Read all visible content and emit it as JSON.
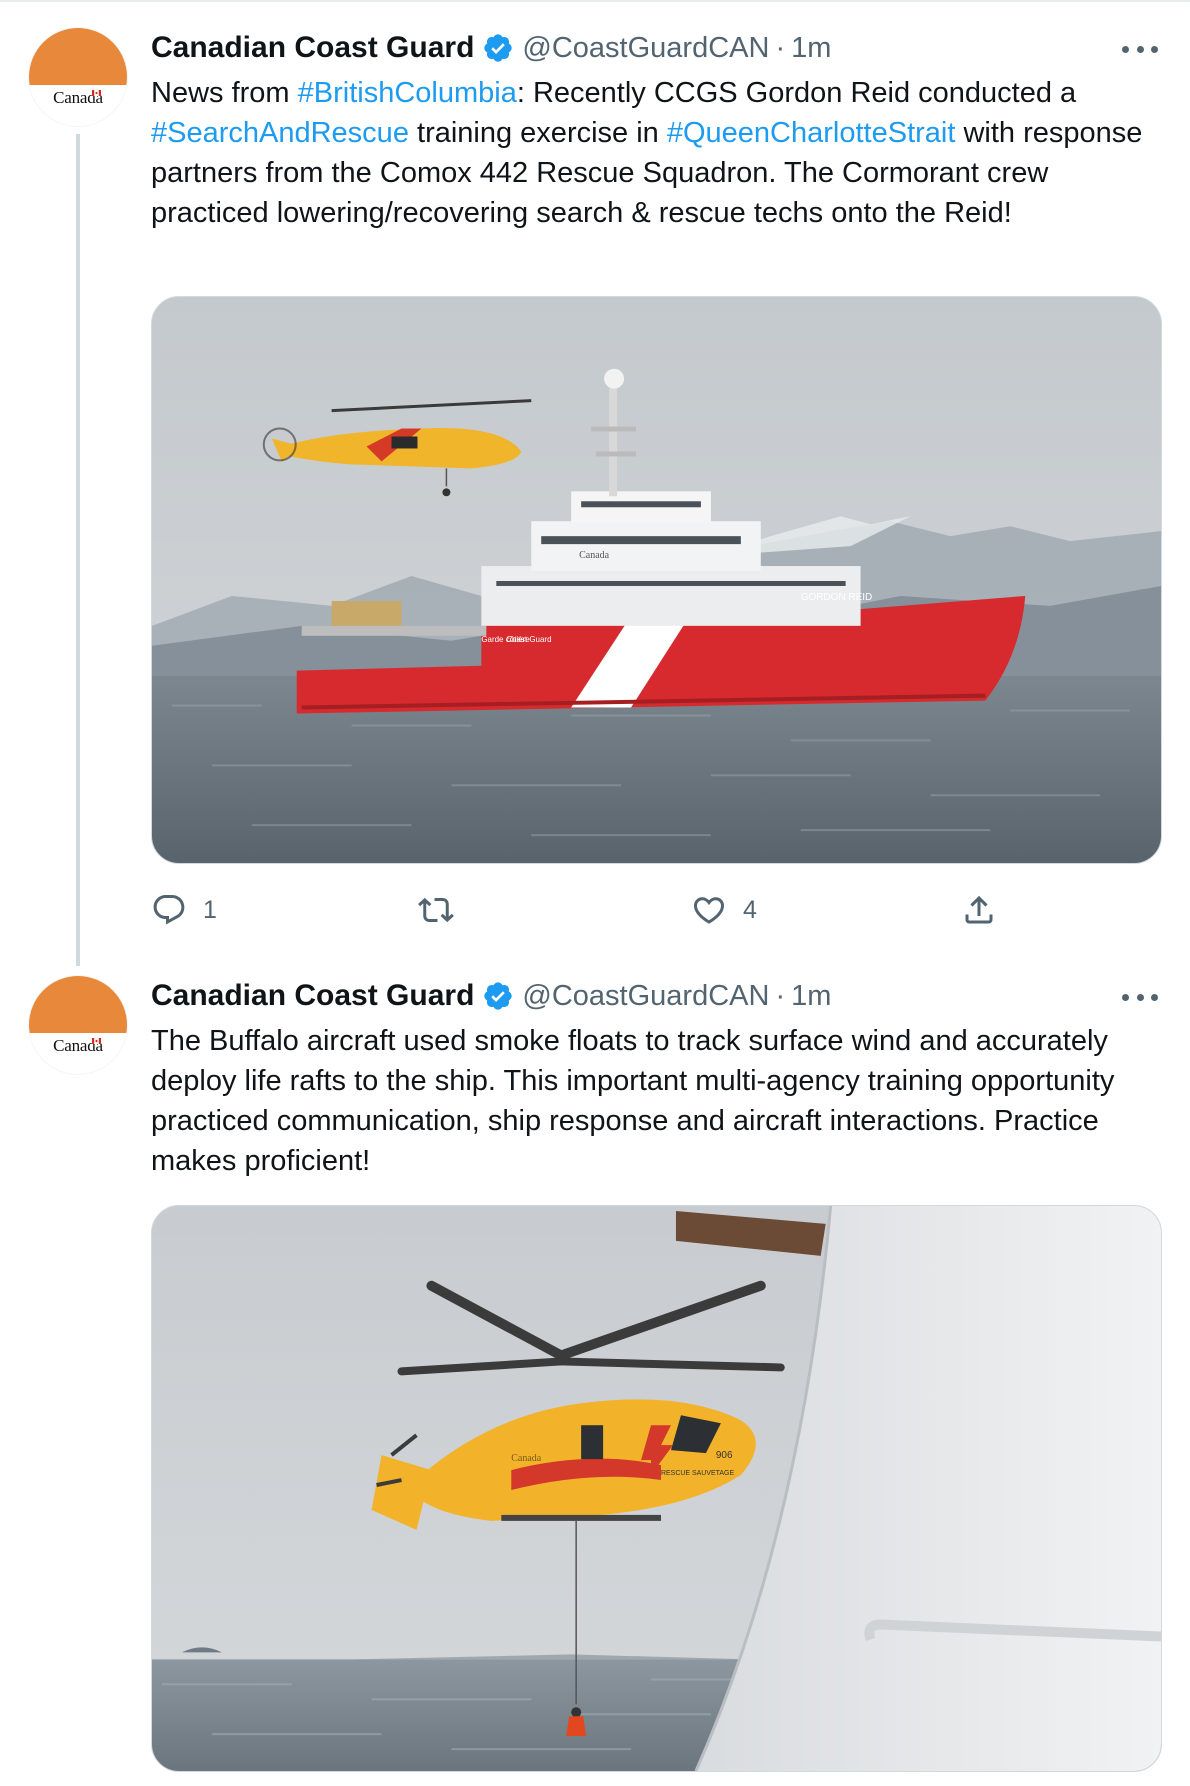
{
  "tweets": [
    {
      "author_name": "Canadian Coast Guard",
      "handle": "@CoastGuardCAN",
      "separator": "·",
      "time": "1m",
      "avatar_wordmark": "Canada",
      "text": {
        "t1": "News from ",
        "h1": "#BritishColumbia",
        "t2": ": Recently CCGS Gordon Reid conducted a ",
        "h2": "#SearchAndRescue",
        "t3": " training exercise in ",
        "h3": "#QueenCharlotteStrait",
        "t4": " with response partners from the Comox 442 Rescue Squadron. The Cormorant crew practiced lowering/recovering search & rescue techs onto the Reid!"
      },
      "image": {
        "ship_name": "GORDON REID",
        "hull_text_fr": "Garde côtière",
        "hull_text_en": "Coast Guard",
        "wordmark": "Canada"
      },
      "actions": {
        "reply_count": "1",
        "retweet_count": "",
        "like_count": "4"
      }
    },
    {
      "author_name": "Canadian Coast Guard",
      "handle": "@CoastGuardCAN",
      "separator": "·",
      "time": "1m",
      "avatar_wordmark": "Canada",
      "text": {
        "t1": "The Buffalo aircraft used smoke floats to track surface wind and accurately deploy life rafts to the ship. This important multi-agency training opportunity practiced communication, ship response and aircraft interactions. Practice makes proficient!"
      },
      "image": {
        "heli_number": "906",
        "heli_text": "RESCUE SAUVETAGE",
        "wordmark": "Canada"
      }
    }
  ],
  "colors": {
    "link": "#1d9bf0",
    "secondary_text": "#536471",
    "avatar_orange": "#e8883a",
    "verified_blue": "#1d9bf0"
  },
  "icons": [
    "reply-icon",
    "retweet-icon",
    "like-icon",
    "share-icon",
    "verified-badge-icon",
    "more-options-icon"
  ]
}
